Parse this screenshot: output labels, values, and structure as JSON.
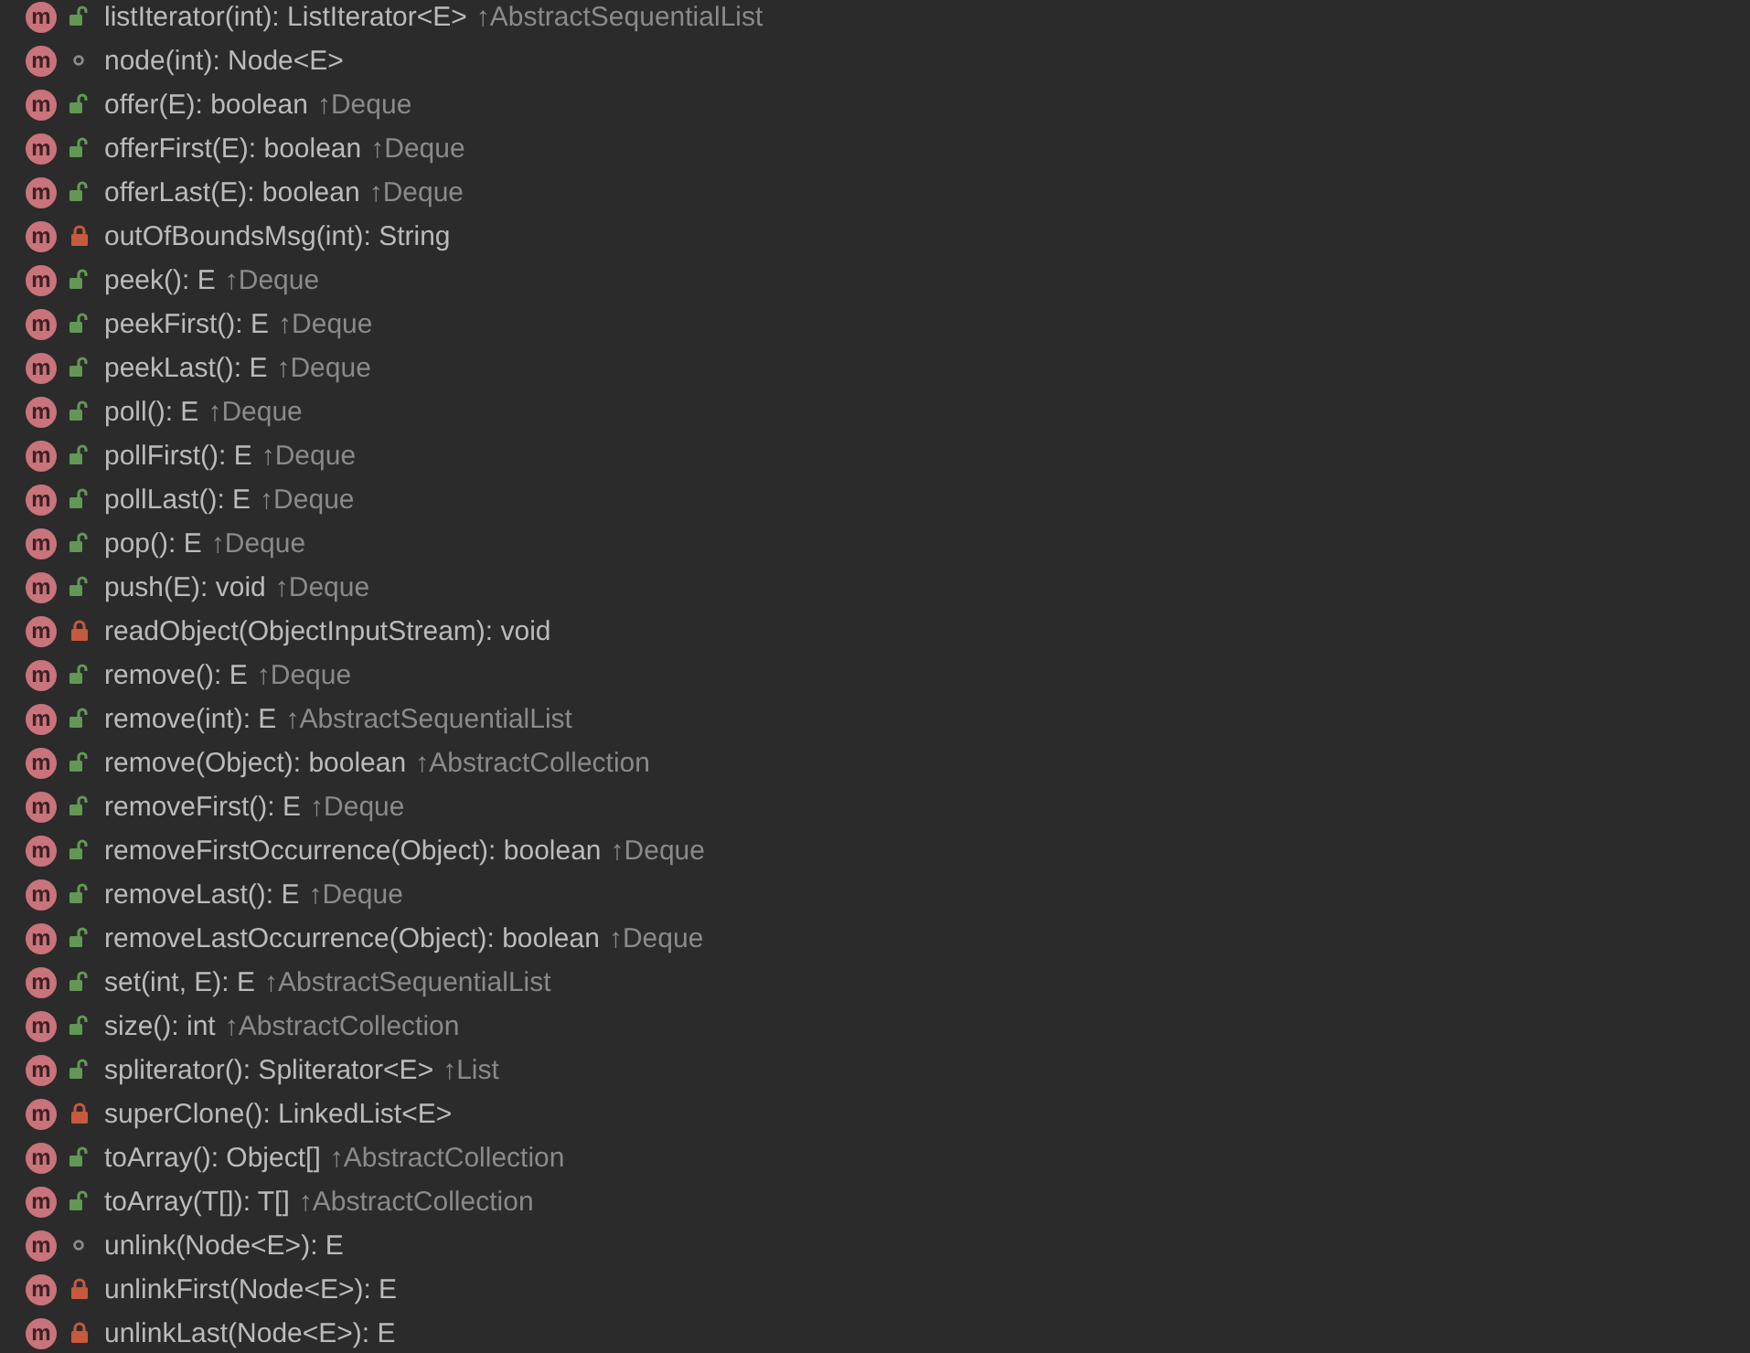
{
  "members": [
    {
      "badge": "m",
      "kind": "public",
      "signature": "listIterator(int): ListIterator<E>",
      "inherited": "↑AbstractSequentialList"
    },
    {
      "badge": "m",
      "kind": "package",
      "signature": "node(int): Node<E>"
    },
    {
      "badge": "m",
      "kind": "public",
      "signature": "offer(E): boolean",
      "inherited": "↑Deque"
    },
    {
      "badge": "m",
      "kind": "public",
      "signature": "offerFirst(E): boolean",
      "inherited": "↑Deque"
    },
    {
      "badge": "m",
      "kind": "public",
      "signature": "offerLast(E): boolean",
      "inherited": "↑Deque"
    },
    {
      "badge": "m",
      "kind": "private",
      "signature": "outOfBoundsMsg(int): String"
    },
    {
      "badge": "m",
      "kind": "public",
      "signature": "peek(): E",
      "inherited": "↑Deque"
    },
    {
      "badge": "m",
      "kind": "public",
      "signature": "peekFirst(): E",
      "inherited": "↑Deque"
    },
    {
      "badge": "m",
      "kind": "public",
      "signature": "peekLast(): E",
      "inherited": "↑Deque"
    },
    {
      "badge": "m",
      "kind": "public",
      "signature": "poll(): E",
      "inherited": "↑Deque"
    },
    {
      "badge": "m",
      "kind": "public",
      "signature": "pollFirst(): E",
      "inherited": "↑Deque"
    },
    {
      "badge": "m",
      "kind": "public",
      "signature": "pollLast(): E",
      "inherited": "↑Deque"
    },
    {
      "badge": "m",
      "kind": "public",
      "signature": "pop(): E",
      "inherited": "↑Deque"
    },
    {
      "badge": "m",
      "kind": "public",
      "signature": "push(E): void",
      "inherited": "↑Deque"
    },
    {
      "badge": "m",
      "kind": "private",
      "signature": "readObject(ObjectInputStream): void"
    },
    {
      "badge": "m",
      "kind": "public",
      "signature": "remove(): E",
      "inherited": "↑Deque"
    },
    {
      "badge": "m",
      "kind": "public",
      "signature": "remove(int): E",
      "inherited": "↑AbstractSequentialList"
    },
    {
      "badge": "m",
      "kind": "public",
      "signature": "remove(Object): boolean",
      "inherited": "↑AbstractCollection"
    },
    {
      "badge": "m",
      "kind": "public",
      "signature": "removeFirst(): E",
      "inherited": "↑Deque"
    },
    {
      "badge": "m",
      "kind": "public",
      "signature": "removeFirstOccurrence(Object): boolean",
      "inherited": "↑Deque"
    },
    {
      "badge": "m",
      "kind": "public",
      "signature": "removeLast(): E",
      "inherited": "↑Deque"
    },
    {
      "badge": "m",
      "kind": "public",
      "signature": "removeLastOccurrence(Object): boolean",
      "inherited": "↑Deque"
    },
    {
      "badge": "m",
      "kind": "public",
      "signature": "set(int, E): E",
      "inherited": "↑AbstractSequentialList"
    },
    {
      "badge": "m",
      "kind": "public",
      "signature": "size(): int",
      "inherited": "↑AbstractCollection"
    },
    {
      "badge": "m",
      "kind": "public",
      "signature": "spliterator(): Spliterator<E>",
      "inherited": "↑List"
    },
    {
      "badge": "m",
      "kind": "private",
      "signature": "superClone(): LinkedList<E>"
    },
    {
      "badge": "m",
      "kind": "public",
      "signature": "toArray(): Object[]",
      "inherited": "↑AbstractCollection"
    },
    {
      "badge": "m",
      "kind": "public",
      "signature": "toArray(T[]): T[]",
      "inherited": "↑AbstractCollection"
    },
    {
      "badge": "m",
      "kind": "package",
      "signature": "unlink(Node<E>): E"
    },
    {
      "badge": "m",
      "kind": "private",
      "signature": "unlinkFirst(Node<E>): E"
    },
    {
      "badge": "m",
      "kind": "private",
      "signature": "unlinkLast(Node<E>): E"
    }
  ]
}
